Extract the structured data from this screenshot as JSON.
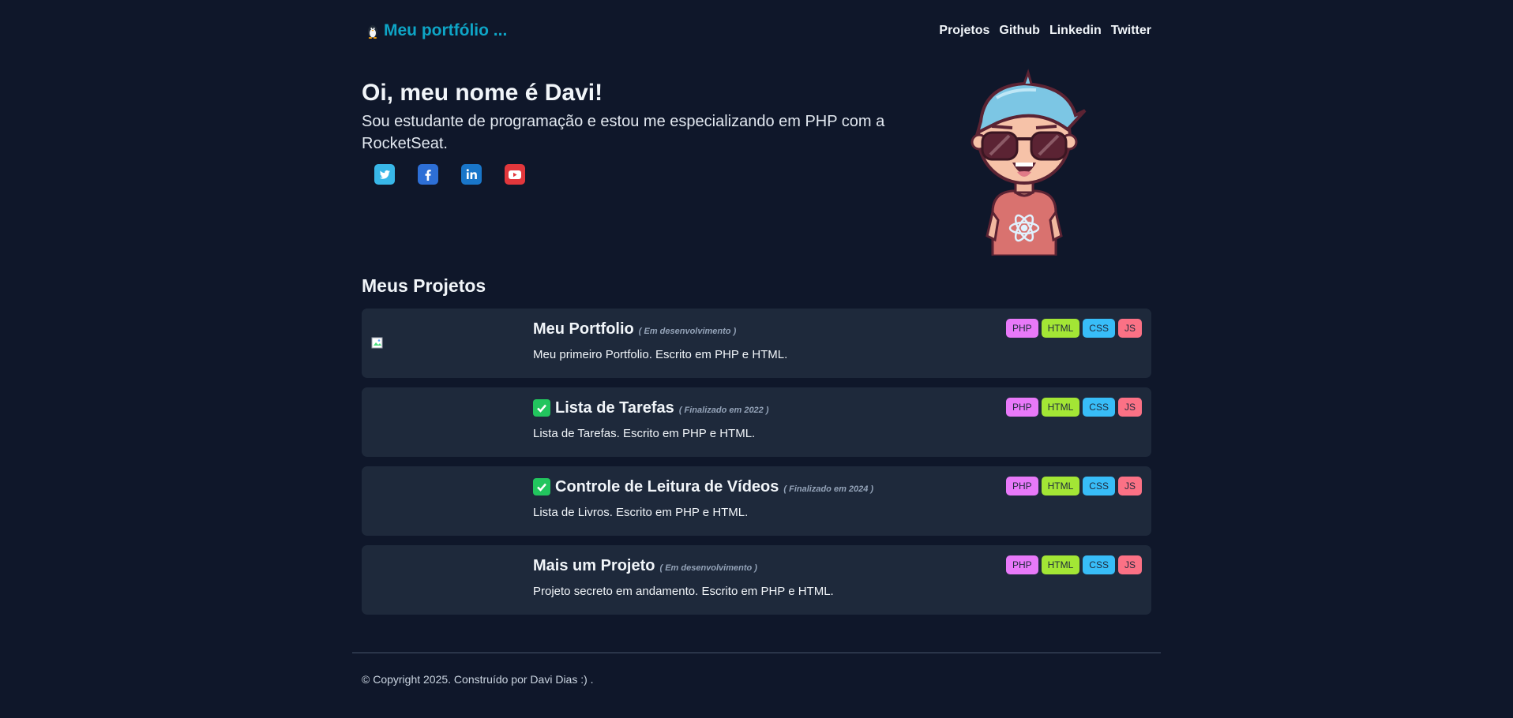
{
  "header": {
    "brand": "Meu portfólio ...",
    "nav": [
      "Projetos",
      "Github",
      "Linkedin",
      "Twitter"
    ]
  },
  "hero": {
    "title": "Oi, meu nome é Davi!",
    "subtitle": "Sou estudante de programação e estou me especializando em PHP com a RocketSeat.",
    "socials": [
      "twitter-icon",
      "facebook-icon",
      "linkedin-icon",
      "youtube-icon"
    ]
  },
  "projects_title": "Meus Projetos",
  "projects": [
    {
      "name": "Meu Portfolio",
      "status": "( Em desenvolvimento )",
      "description": "Meu primeiro Portfolio. Escrito em PHP e HTML.",
      "done": false,
      "tags": [
        "PHP",
        "HTML",
        "CSS",
        "JS"
      ]
    },
    {
      "name": "Lista de Tarefas",
      "status": "( Finalizado em 2022 )",
      "description": "Lista de Tarefas. Escrito em PHP e HTML.",
      "done": true,
      "tags": [
        "PHP",
        "HTML",
        "CSS",
        "JS"
      ]
    },
    {
      "name": "Controle de Leitura de Vídeos",
      "status": "( Finalizado em 2024 )",
      "description": "Lista de Livros. Escrito em PHP e HTML.",
      "done": true,
      "tags": [
        "PHP",
        "HTML",
        "CSS",
        "JS"
      ]
    },
    {
      "name": "Mais um Projeto",
      "status": "( Em desenvolvimento )",
      "description": "Projeto secreto em andamento. Escrito em PHP e HTML.",
      "done": false,
      "tags": [
        "PHP",
        "HTML",
        "CSS",
        "JS"
      ]
    }
  ],
  "footer": "© Copyright 2025. Construído por Davi Dias :) .",
  "colors": {
    "background": "#0f172a",
    "card": "#1e293b",
    "brand": "#0ea5c6",
    "tag_php": "#e879f9",
    "tag_html": "#a3e635",
    "tag_css": "#38bdf8",
    "tag_js": "#fb7185"
  }
}
